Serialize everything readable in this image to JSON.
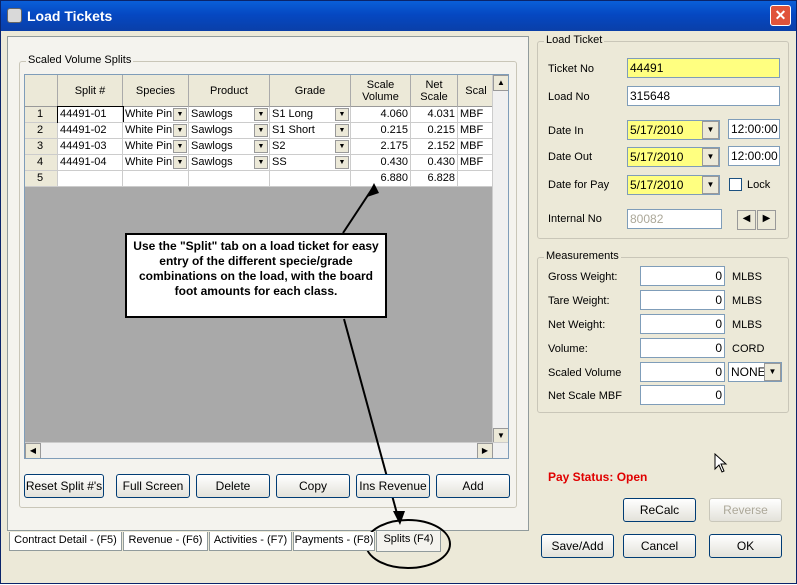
{
  "window": {
    "title": "Load Tickets",
    "close": "✕"
  },
  "splits": {
    "group_label": "Scaled Volume Splits",
    "columns": [
      "Split #",
      "Species",
      "Product",
      "Grade",
      "Scale Volume",
      "Net Scale",
      "Scal"
    ],
    "rows": [
      {
        "n": "1",
        "split": "44491-01",
        "species": "White Pin",
        "product": "Sawlogs",
        "grade": "S1 Long",
        "volume": "4.060",
        "net": "4.031",
        "unit": "MBF"
      },
      {
        "n": "2",
        "split": "44491-02",
        "species": "White Pin",
        "product": "Sawlogs",
        "grade": "S1 Short",
        "volume": "0.215",
        "net": "0.215",
        "unit": "MBF"
      },
      {
        "n": "3",
        "split": "44491-03",
        "species": "White Pin",
        "product": "Sawlogs",
        "grade": "S2",
        "volume": "2.175",
        "net": "2.152",
        "unit": "MBF"
      },
      {
        "n": "4",
        "split": "44491-04",
        "species": "White Pin",
        "product": "Sawlogs",
        "grade": "SS",
        "volume": "0.430",
        "net": "0.430",
        "unit": "MBF"
      },
      {
        "n": "5",
        "split": "",
        "species": "",
        "product": "",
        "grade": "",
        "volume": "6.880",
        "net": "6.828",
        "unit": ""
      }
    ]
  },
  "callout": "Use the \"Split\" tab on a load ticket for easy entry of the different specie/grade combinations on the load, with the board foot amounts for each class.",
  "buttons": {
    "reset": "Reset Split #'s",
    "full": "Full Screen",
    "delete": "Delete",
    "copy": "Copy",
    "ins": "Ins Revenue",
    "add": "Add",
    "recalc": "ReCalc",
    "reverse": "Reverse",
    "saveadd": "Save/Add",
    "cancel": "Cancel",
    "ok": "OK"
  },
  "tabs": [
    "Contract Detail - (F5)",
    "Revenue  - (F6)",
    "Activities - (F7)",
    "Payments - (F8)",
    "Splits (F4)"
  ],
  "load_ticket": {
    "label": "Load Ticket",
    "ticket_no_label": "Ticket No",
    "ticket_no": "44491",
    "load_no_label": "Load No",
    "load_no": "315648",
    "date_in_label": "Date In",
    "date_in": "5/17/2010",
    "time_in": "12:00:00",
    "date_out_label": "Date Out",
    "date_out": "5/17/2010",
    "time_out": "12:00:00",
    "date_pay_label": "Date for Pay",
    "date_pay": "5/17/2010",
    "lock_label": "Lock",
    "internal_label": "Internal No",
    "internal_no": "80082"
  },
  "measurements": {
    "label": "Measurements",
    "gross_label": "Gross Weight:",
    "gross": "0",
    "gross_unit": "MLBS",
    "tare_label": "Tare Weight:",
    "tare": "0",
    "tare_unit": "MLBS",
    "net_label": "Net Weight:",
    "net": "0",
    "net_unit": "MLBS",
    "volume_label": "Volume:",
    "volume": "0",
    "volume_unit": "CORD",
    "scaled_label": "Scaled Volume",
    "scaled": "0",
    "scaled_unit": "NONE",
    "netscale_label": "Net Scale MBF",
    "netscale": "0"
  },
  "pay_status": "Pay Status: Open",
  "icons": {
    "nav_prev": "◀",
    "nav_next": "▶",
    "dropdown": "▼"
  }
}
